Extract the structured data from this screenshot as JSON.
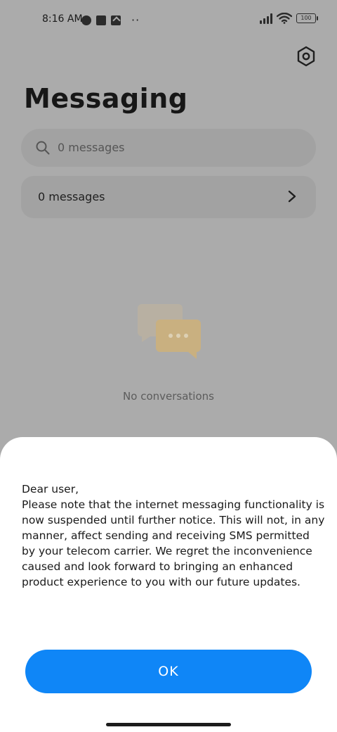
{
  "status_bar": {
    "time": "8:16 AM",
    "more_indicator": "··",
    "battery_level": "100"
  },
  "header": {
    "title": "Messaging",
    "settings_icon": "gear-hex-icon"
  },
  "search": {
    "placeholder": "0 messages",
    "icon": "search-icon"
  },
  "messages_row": {
    "label": "0 messages",
    "icon": "chevron-right-icon"
  },
  "empty_state": {
    "icon": "chat-bubbles-icon",
    "text": "No conversations"
  },
  "dialog": {
    "message": "Dear user,\nPlease note that the internet messaging functionality is now suspended until further notice. This will not, in any manner, affect sending and receiving SMS permitted by your telecom carrier. We regret the inconvenience caused and look forward to bringing an enhanced product experience to you with our future updates.",
    "ok_label": "OK"
  },
  "colors": {
    "scrim_background": "#ababab",
    "primary_button": "#0f86f7",
    "illustration_front": "#c9b080",
    "illustration_back": "#b8b0a2"
  }
}
